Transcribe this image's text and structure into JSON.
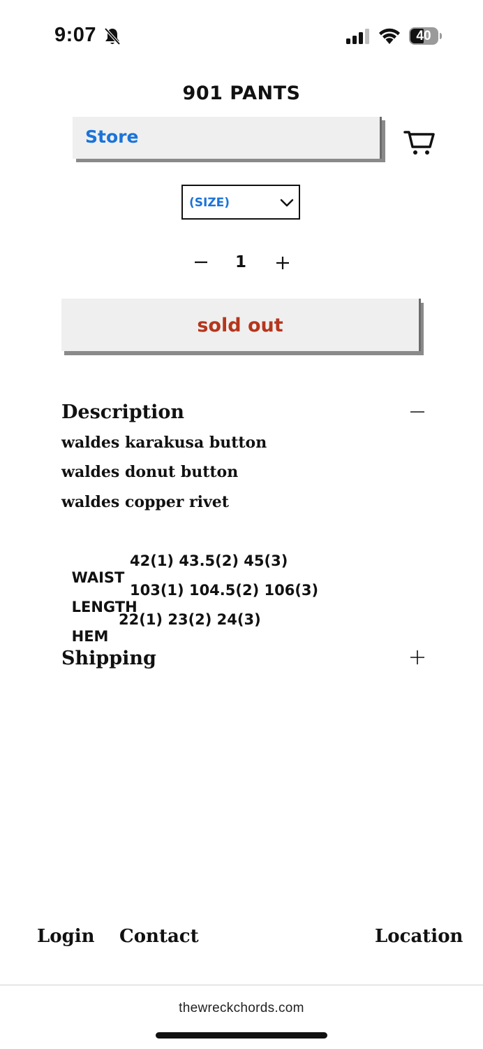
{
  "status_bar": {
    "time": "9:07",
    "battery": "40",
    "icons": [
      "bell-slash-icon",
      "cellular-signal-icon",
      "wifi-icon",
      "battery-icon"
    ]
  },
  "header": {
    "title": "901 PANTS",
    "store_label": "Store",
    "cart_icon": "cart-icon"
  },
  "product": {
    "size_select": {
      "selected": "(SIZE)"
    },
    "quantity": {
      "minus": "−",
      "value": "1",
      "plus": "+"
    },
    "sold_out_label": "sold out"
  },
  "description": {
    "title": "Description",
    "lines": [
      "waldes karakusa button",
      "waldes donut button",
      "waldes copper rivet"
    ],
    "specs": [
      {
        "label": "WAIST",
        "value": "42(1) 43.5(2) 45(3)"
      },
      {
        "label": "LENGTH",
        "value": "103(1) 104.5(2) 106(3)"
      },
      {
        "label": "HEM",
        "value": "22(1) 23(2) 24(3)"
      }
    ]
  },
  "shipping": {
    "title": "Shipping"
  },
  "footer": {
    "login": "Login",
    "contact": "Contact",
    "location": "Location"
  },
  "browser": {
    "url": "thewreckchords.com"
  },
  "colors": {
    "link_blue": "#1a73d9",
    "sold_out_red": "#b5361c",
    "button_gray": "#efefef"
  }
}
